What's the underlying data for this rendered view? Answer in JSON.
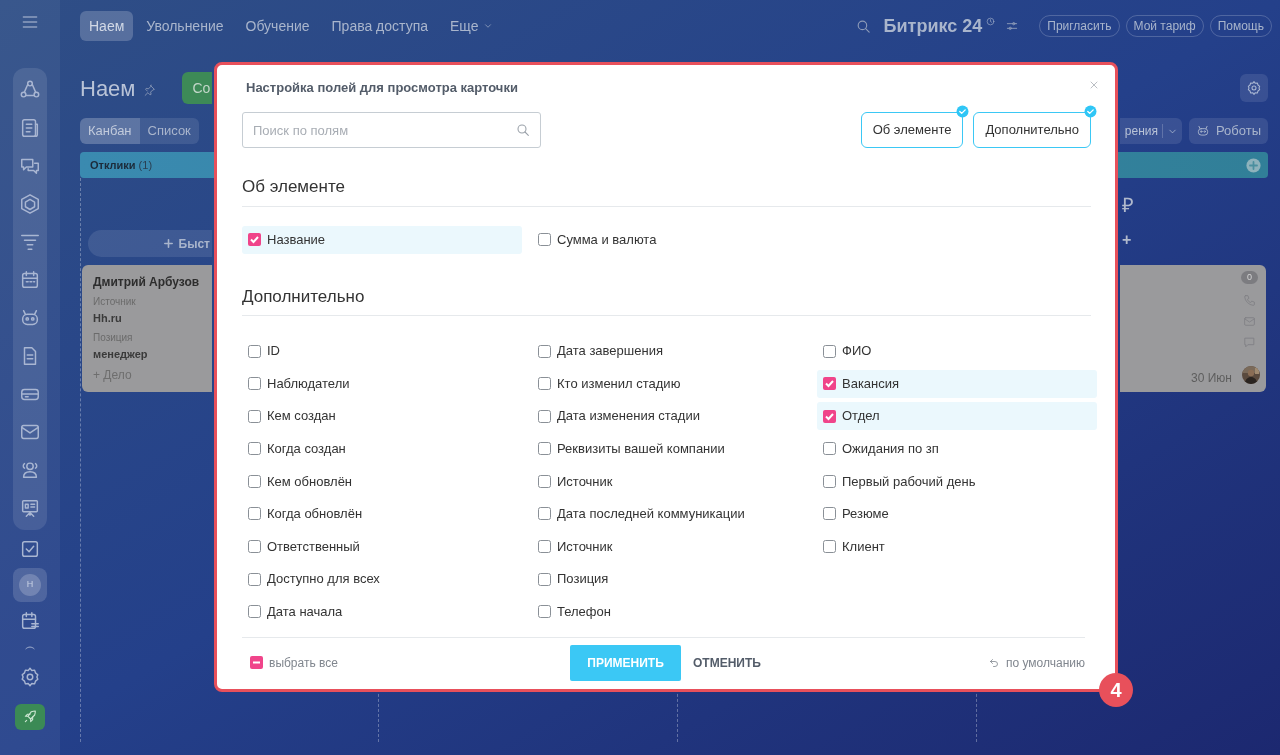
{
  "top_nav": {
    "tabs": [
      {
        "label": "Наем",
        "selected": true
      },
      {
        "label": "Увольнение",
        "selected": false
      },
      {
        "label": "Обучение",
        "selected": false
      },
      {
        "label": "Права доступа",
        "selected": false
      }
    ],
    "more": "Еще",
    "brand": "Битрикс 24",
    "buttons": [
      "Пригласить",
      "Мой тариф",
      "Помощь"
    ]
  },
  "sidebar": {
    "avatar": "Н"
  },
  "page": {
    "title": "Наем",
    "create_button": "Со",
    "view_tabs": [
      {
        "label": "Канбан",
        "selected": true
      },
      {
        "label": "Список",
        "selected": false
      }
    ],
    "view_button": "рения",
    "robots_button": "Роботы"
  },
  "kanban": {
    "column": {
      "title": "Отклики",
      "count": "(1)",
      "quick_add": "Быст"
    },
    "card": {
      "name": "Дмитрий Арбузов",
      "fields": [
        {
          "label": "Источник",
          "value": "Hh.ru"
        },
        {
          "label": "Позиция",
          "value": "менеджер"
        }
      ],
      "add_activity": "+ Дело"
    },
    "right_column": {
      "sum": "₽",
      "quick_add": "+"
    },
    "right_card": {
      "counter": "0",
      "date": "30 Июн"
    }
  },
  "modal": {
    "title": "Настройка полей для просмотра карточки",
    "search_placeholder": "Поиск по полям",
    "filters": [
      {
        "label": "Об элементе",
        "checked": true
      },
      {
        "label": "Дополнительно",
        "checked": true
      }
    ],
    "sections": [
      {
        "title": "Об элементе",
        "columns": [
          [
            {
              "label": "Название",
              "checked": true
            }
          ],
          [
            {
              "label": "Сумма и валюта",
              "checked": false
            }
          ]
        ]
      },
      {
        "title": "Дополнительно",
        "columns": [
          [
            {
              "label": "ID",
              "checked": false
            },
            {
              "label": "Наблюдатели",
              "checked": false
            },
            {
              "label": "Кем создан",
              "checked": false
            },
            {
              "label": "Когда создан",
              "checked": false
            },
            {
              "label": "Кем обновлён",
              "checked": false
            },
            {
              "label": "Когда обновлён",
              "checked": false
            },
            {
              "label": "Ответственный",
              "checked": false
            },
            {
              "label": "Доступно для всех",
              "checked": false
            },
            {
              "label": "Дата начала",
              "checked": false
            }
          ],
          [
            {
              "label": "Дата завершения",
              "checked": false
            },
            {
              "label": "Кто изменил стадию",
              "checked": false
            },
            {
              "label": "Дата изменения стадии",
              "checked": false
            },
            {
              "label": "Реквизиты вашей компании",
              "checked": false
            },
            {
              "label": "Источник",
              "checked": false
            },
            {
              "label": "Дата последней коммуникации",
              "checked": false
            },
            {
              "label": "Источник",
              "checked": false
            },
            {
              "label": "Позиция",
              "checked": false
            },
            {
              "label": "Телефон",
              "checked": false
            }
          ],
          [
            {
              "label": "ФИО",
              "checked": false
            },
            {
              "label": "Вакансия",
              "checked": true
            },
            {
              "label": "Отдел",
              "checked": true
            },
            {
              "label": "Ожидания по зп",
              "checked": false
            },
            {
              "label": "Первый рабочий день",
              "checked": false
            },
            {
              "label": "Резюме",
              "checked": false
            },
            {
              "label": "Клиент",
              "checked": false
            }
          ]
        ]
      }
    ],
    "select_all": {
      "label": "выбрать все",
      "indeterminate": true
    },
    "apply": "ПРИМЕНИТЬ",
    "cancel": "ОТМЕНИТЬ",
    "reset": "по умолчанию"
  },
  "step_badge": "4"
}
